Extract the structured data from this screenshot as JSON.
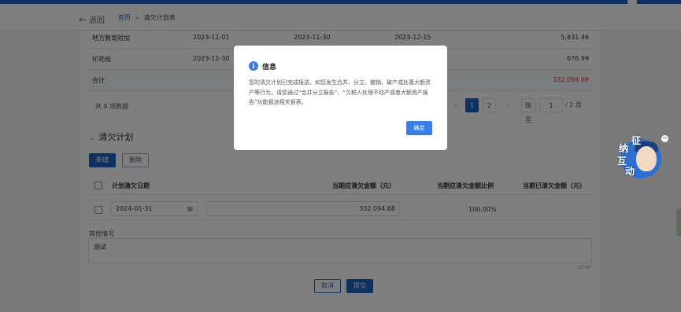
{
  "header": {
    "back_label": "返回",
    "breadcrumb_home": "首页",
    "breadcrumb_current": "清欠计划表"
  },
  "tax_rows": [
    {
      "name": "地方教育附加",
      "date1": "2023-11-01",
      "date2": "2023-11-30",
      "date3": "2023-12-15",
      "amount": "5,831.46"
    },
    {
      "name": "印花税",
      "date1": "2023-11-30",
      "date2": "",
      "date3": "",
      "amount": "676.99"
    }
  ],
  "total_row": {
    "label": "合计",
    "amount": "332,094.68"
  },
  "pagination": {
    "summary": "共 8 项数据",
    "prev": "‹",
    "pages": [
      "1",
      "2"
    ],
    "next": "›",
    "jump_label": "跳至",
    "jump_value": "1",
    "total_pages": "/ 2 页"
  },
  "plan_section": {
    "title": "清欠计划",
    "add_label": "新增",
    "delete_label": "删除",
    "columns": [
      "计划清欠日期",
      "当期应清欠金额（元）",
      "当期应清欠金额比例",
      "当期已清欠金额（元）"
    ],
    "row": {
      "date": "2024-01-31",
      "amount": "332,094.68",
      "ratio": "100.00%"
    }
  },
  "other": {
    "label": "其他情况",
    "value": "测试",
    "counter": "2/500"
  },
  "footer": {
    "cancel_label": "取消",
    "submit_label": "提交"
  },
  "modal": {
    "title": "信息",
    "message": "您的清欠计划已完成报送。如您发生合并、分立、撤销、破产或处置大额资产等行为，请您通过“合并分立报告”、“欠税人处理不动产或者大额资产报告”功能报送相关报表。",
    "ok_label": "确定"
  },
  "mascot": {
    "chars": [
      "征",
      "纳",
      "互",
      "动"
    ]
  },
  "colors": {
    "primary": "#1d63c4",
    "dialog_button": "#3a7ee6",
    "total_red": "#e0403d"
  },
  "icons": {
    "info": "info-circle-icon",
    "calendar": "calendar-icon",
    "chevron": "chevron-down-icon",
    "minimize": "minus-circle-icon"
  }
}
